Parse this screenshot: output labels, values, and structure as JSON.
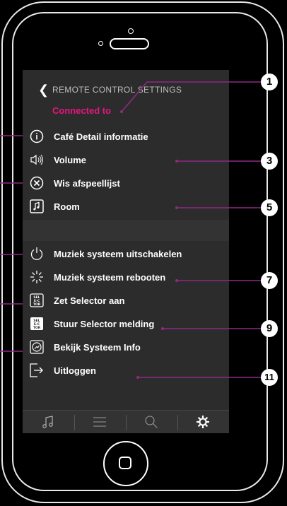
{
  "header": {
    "title": "REMOTE CONTROL SETTINGS",
    "subtitle": "Connected to"
  },
  "menu": [
    {
      "label": "Café Detail informatie",
      "icon": "info-icon"
    },
    {
      "label": "Volume",
      "icon": "speaker-icon"
    },
    {
      "label": "Wis afspeellijst",
      "icon": "close-circle-icon"
    },
    {
      "label": "Room",
      "icon": "music-note-icon"
    },
    {
      "label": "Muziek systeem uitschakelen",
      "icon": "power-icon"
    },
    {
      "label": "Muziek systeem rebooten",
      "icon": "reboot-burst-icon"
    },
    {
      "label": "Zet Selector aan",
      "icon": "selector-icon"
    },
    {
      "label": "Stuur Selector melding",
      "icon": "selector-message-icon"
    },
    {
      "label": "Bekijk Systeem Info",
      "icon": "system-info-icon"
    },
    {
      "label": "Uitloggen",
      "icon": "logout-icon"
    }
  ],
  "selector_icon_text": "SEL\nE-C\nTOR",
  "tabs": [
    "music-note-icon",
    "list-icon",
    "search-icon",
    "gear-icon"
  ],
  "callouts": [
    "1",
    "3",
    "5",
    "7",
    "9",
    "11"
  ],
  "colors": {
    "accent": "#e6157e",
    "line": "#8e2a84"
  }
}
